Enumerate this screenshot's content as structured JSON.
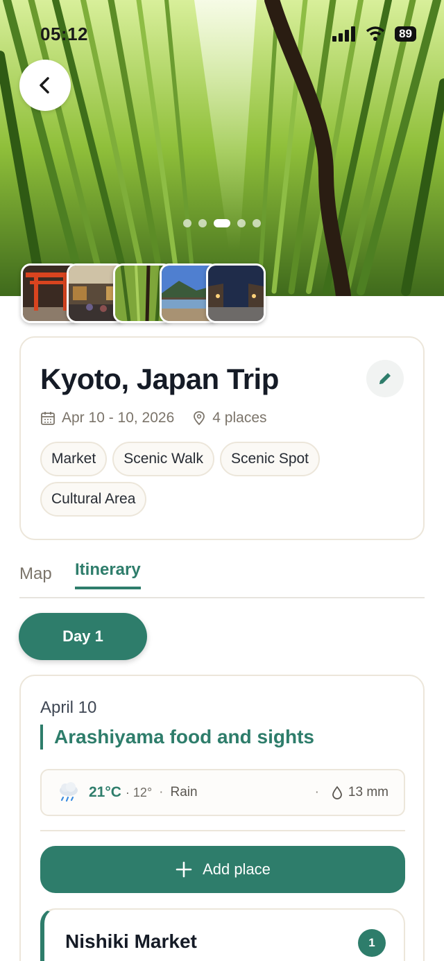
{
  "status_bar": {
    "time": "05:12",
    "battery": "89"
  },
  "hero": {
    "back_icon": "chevron-left-icon",
    "carousel_dots": 5,
    "carousel_active_index": 2,
    "thumbnails": [
      "torii-gate-photo",
      "market-street-photo",
      "bamboo-grove-photo",
      "river-bridge-photo",
      "night-street-photo"
    ]
  },
  "trip": {
    "title": "Kyoto, Japan Trip",
    "dates": "Apr 10 - 10, 2026",
    "places": "4 places",
    "tags": [
      "Market",
      "Scenic Walk",
      "Scenic Spot",
      "Cultural Area"
    ]
  },
  "tabs": {
    "map": "Map",
    "itinerary": "Itinerary",
    "active": "Itinerary"
  },
  "day_selector": {
    "label": "Day 1"
  },
  "day": {
    "date": "April 10",
    "theme": "Arashiyama food and sights",
    "weather": {
      "icon": "rain-cloud-icon",
      "high": "21°C",
      "low": "· 12°",
      "sep": "·",
      "condition": "Rain",
      "precip_sep": "·",
      "precip": "13 mm"
    },
    "add_place_label": "Add place",
    "places": [
      {
        "name": "Nishiki Market",
        "order": "1"
      }
    ]
  },
  "colors": {
    "accent": "#2e7d6b",
    "border": "#ece6da",
    "muted": "#7b746a"
  }
}
